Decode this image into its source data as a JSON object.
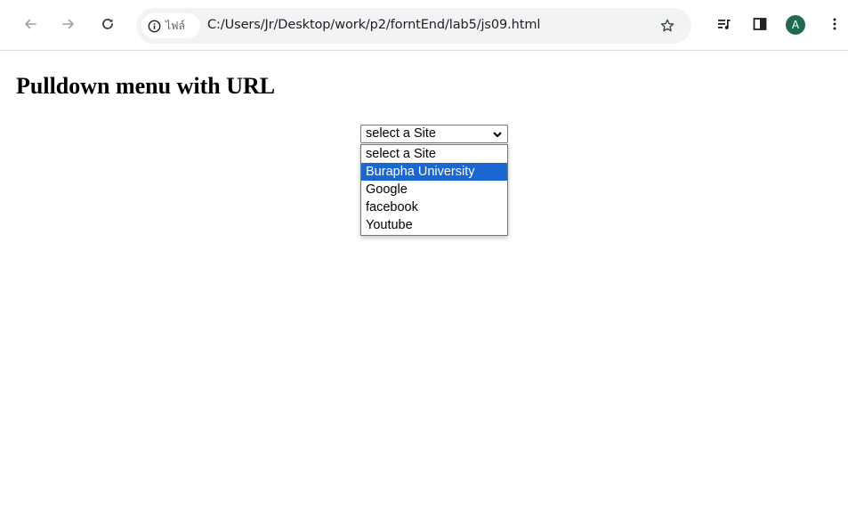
{
  "browser": {
    "site_chip_label": "ไฟล์",
    "url": "C:/Users/Jr/Desktop/work/p2/forntEnd/lab5/js09.html",
    "profile_initial": "A",
    "icons": {
      "back": "arrow-left-icon",
      "forward": "arrow-right-icon",
      "reload": "reload-icon",
      "info": "info-icon",
      "bookmark": "star-icon",
      "reading_list": "media-queue-icon",
      "side_panel": "side-panel-icon",
      "menu": "kebab-menu-icon"
    }
  },
  "page": {
    "title": "Pulldown menu with URL",
    "select": {
      "value": "select a Site",
      "options": [
        "select a Site",
        "Burapha University",
        "Google",
        "facebook",
        "Youtube"
      ],
      "highlighted_option": "Burapha University"
    }
  },
  "colors": {
    "highlight": "#1a67d2",
    "avatar": "#1e6b52",
    "omnibox": "#f1f3f4"
  }
}
